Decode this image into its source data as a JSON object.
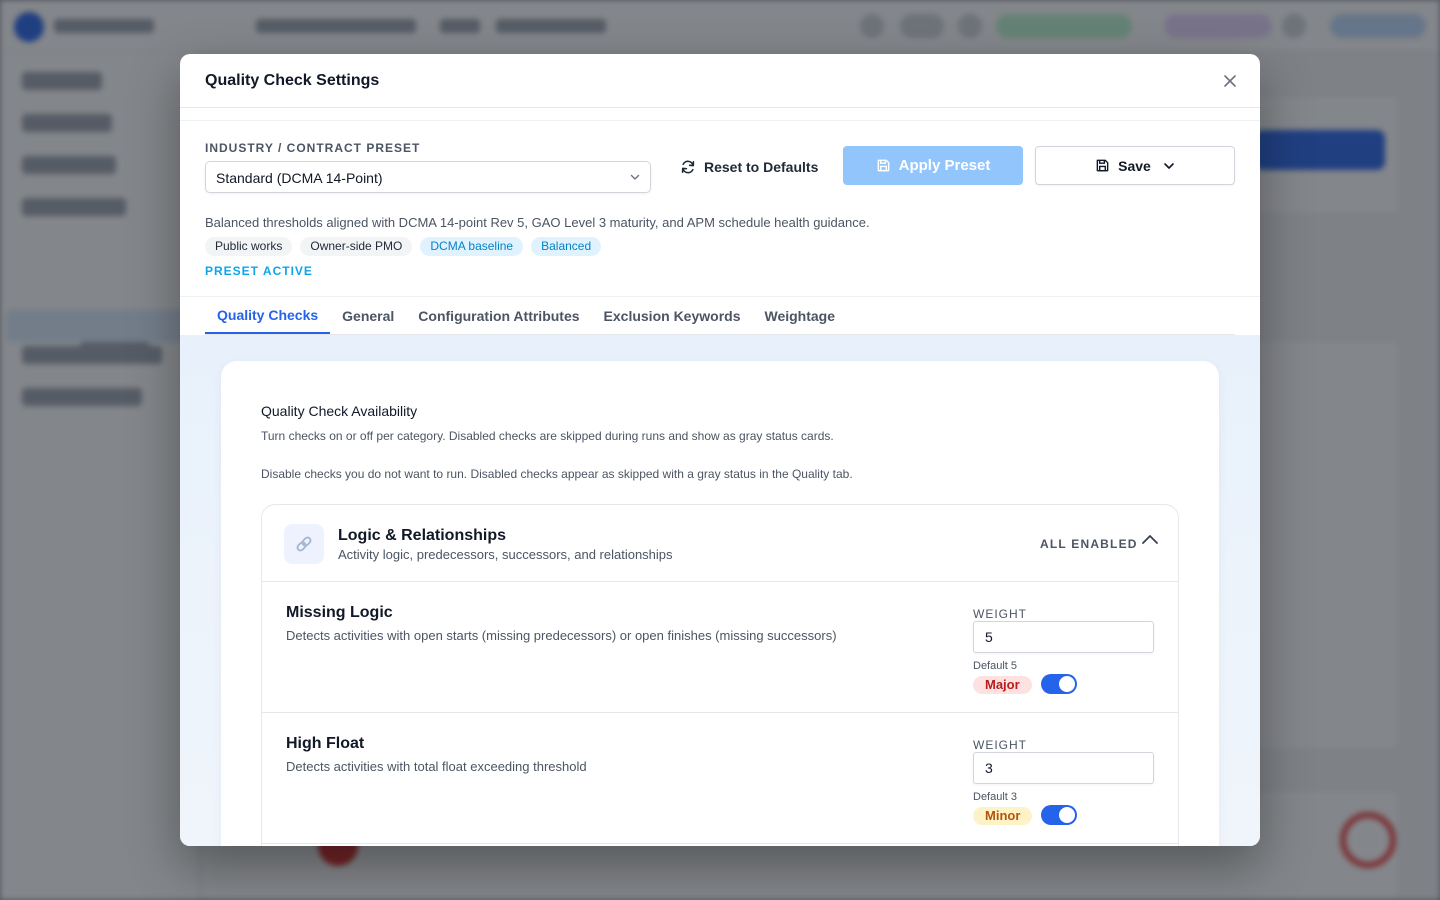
{
  "modal": {
    "title": "Quality Check Settings"
  },
  "preset": {
    "label": "INDUSTRY / CONTRACT PRESET",
    "selected": "Standard (DCMA 14-Point)",
    "reset_label": "Reset to Defaults",
    "apply_label": "Apply Preset",
    "save_label": "Save",
    "description": "Balanced thresholds aligned with DCMA 14-point Rev 5, GAO Level 3 maturity, and APM schedule health guidance.",
    "tags": [
      "Public works",
      "Owner-side PMO",
      "DCMA baseline",
      "Balanced"
    ],
    "status": "PRESET ACTIVE"
  },
  "tabs": [
    "Quality Checks",
    "General",
    "Configuration Attributes",
    "Exclusion Keywords",
    "Weightage"
  ],
  "panel": {
    "title": "Quality Check Availability",
    "subtitle": "Turn checks on or off per category. Disabled checks are skipped during runs and show as gray status cards.",
    "note": "Disable checks you do not want to run. Disabled checks appear as skipped with a gray status in the Quality tab."
  },
  "group": {
    "title": "Logic & Relationships",
    "description": "Activity logic, predecessors, successors, and relationships",
    "status": "ALL ENABLED",
    "checks": [
      {
        "name": "Missing Logic",
        "description": "Detects activities with open starts (missing predecessors) or open finishes (missing successors)",
        "weight_label": "WEIGHT",
        "weight": "5",
        "default": "Default 5",
        "severity": "Major"
      },
      {
        "name": "High Float",
        "description": "Detects activities with total float exceeding threshold",
        "weight_label": "WEIGHT",
        "weight": "3",
        "default": "Default 3",
        "severity": "Minor"
      }
    ]
  },
  "colors": {
    "accent": "#2563eb",
    "apply_disabled": "#93c5fd",
    "preset_active": "#0ea5e9"
  }
}
